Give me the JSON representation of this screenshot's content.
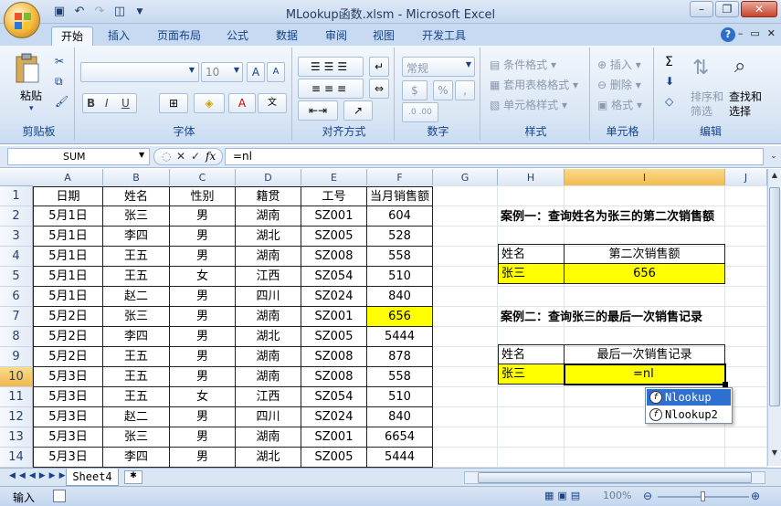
{
  "window": {
    "title": "MLookup函数.xlsm - Microsoft Excel"
  },
  "tabs": [
    "开始",
    "插入",
    "页面布局",
    "公式",
    "数据",
    "审阅",
    "视图",
    "开发工具"
  ],
  "ribbon": {
    "clipboard": {
      "paste": "粘贴",
      "label": "剪贴板"
    },
    "font": {
      "size": "10",
      "label": "字体",
      "bold": "B",
      "italic": "I",
      "underline": "U"
    },
    "alignment": {
      "label": "对齐方式"
    },
    "number": {
      "format": "常规",
      "percent": "%",
      "comma": ",",
      "label": "数字"
    },
    "styles": {
      "conditional": "条件格式",
      "table": "套用表格格式",
      "cell": "单元格样式",
      "label": "样式"
    },
    "cells": {
      "insert": "插入",
      "delete": "删除",
      "format": "格式",
      "label": "单元格"
    },
    "editing": {
      "sum": "Σ",
      "sort": "排序和\n筛选",
      "find": "查找和\n选择",
      "label": "编辑"
    }
  },
  "formula_bar": {
    "name_box": "SUM",
    "formula": "=nl"
  },
  "columns": [
    "A",
    "B",
    "C",
    "D",
    "E",
    "F",
    "G",
    "H",
    "I",
    "J"
  ],
  "rows": [
    "1",
    "2",
    "3",
    "4",
    "5",
    "6",
    "7",
    "8",
    "9",
    "10",
    "11",
    "12",
    "13",
    "14"
  ],
  "table": {
    "headers": [
      "日期",
      "姓名",
      "性别",
      "籍贯",
      "工号",
      "当月销售额"
    ],
    "rows": [
      [
        "5月1日",
        "张三",
        "男",
        "湖南",
        "SZ001",
        "604"
      ],
      [
        "5月1日",
        "李四",
        "男",
        "湖北",
        "SZ005",
        "528"
      ],
      [
        "5月1日",
        "王五",
        "男",
        "湖南",
        "SZ008",
        "558"
      ],
      [
        "5月1日",
        "王五",
        "女",
        "江西",
        "SZ054",
        "510"
      ],
      [
        "5月1日",
        "赵二",
        "男",
        "四川",
        "SZ024",
        "840"
      ],
      [
        "5月2日",
        "张三",
        "男",
        "湖南",
        "SZ001",
        "656"
      ],
      [
        "5月2日",
        "李四",
        "男",
        "湖北",
        "SZ005",
        "5444"
      ],
      [
        "5月2日",
        "王五",
        "男",
        "湖南",
        "SZ008",
        "878"
      ],
      [
        "5月3日",
        "王五",
        "男",
        "湖南",
        "SZ008",
        "558"
      ],
      [
        "5月3日",
        "王五",
        "女",
        "江西",
        "SZ054",
        "510"
      ],
      [
        "5月3日",
        "赵二",
        "男",
        "四川",
        "SZ024",
        "840"
      ],
      [
        "5月3日",
        "张三",
        "男",
        "湖南",
        "SZ001",
        "6654"
      ],
      [
        "5月3日",
        "李四",
        "男",
        "湖北",
        "SZ005",
        "5444"
      ]
    ]
  },
  "case1": {
    "title": "案例一：查询姓名为张三的第二次销售额",
    "h1": "姓名",
    "h2": "第二次销售额",
    "name": "张三",
    "value": "656"
  },
  "case2": {
    "title": "案例二：查询张三的最后一次销售记录",
    "h1": "姓名",
    "h2": "最后一次销售记录",
    "name": "张三",
    "editing": "=nl"
  },
  "autocomplete": [
    "Nlookup",
    "Nlookup2"
  ],
  "sheet_tab": "Sheet4",
  "status": {
    "mode": "输入",
    "zoom": "100%"
  },
  "colors": {
    "highlight": "#ffff00",
    "selection": "#f0b84d",
    "ribbon": "#dbe7f5"
  }
}
